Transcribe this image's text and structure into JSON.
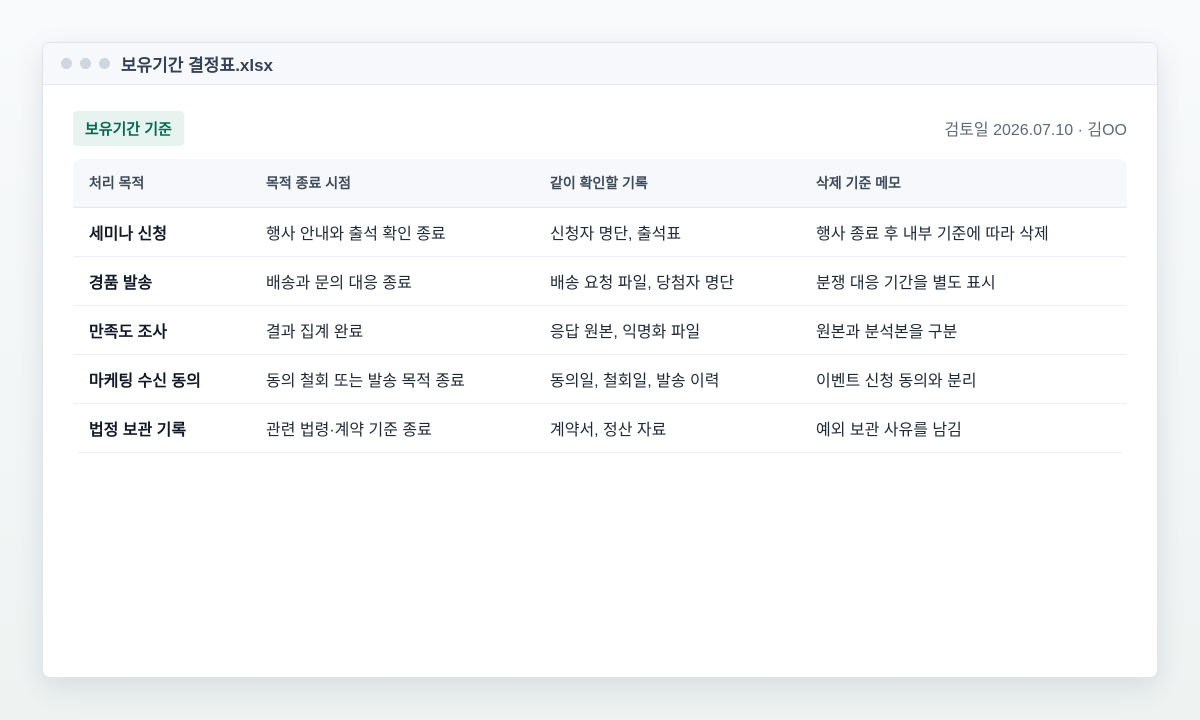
{
  "window": {
    "title": "보유기간 결정표.xlsx"
  },
  "header": {
    "badge": "보유기간 기준",
    "meta": "검토일 2026.07.10 · 김OO"
  },
  "table": {
    "columns": [
      "처리 목적",
      "목적 종료 시점",
      "같이 확인할 기록",
      "삭제 기준 메모"
    ],
    "rows": [
      {
        "purpose": "세미나 신청",
        "end_point": "행사 안내와 출석 확인 종료",
        "records": "신청자 명단, 출석표",
        "memo": "행사 종료 후 내부 기준에 따라 삭제"
      },
      {
        "purpose": "경품 발송",
        "end_point": "배송과 문의 대응 종료",
        "records": "배송 요청 파일, 당첨자 명단",
        "memo": "분쟁 대응 기간을 별도 표시"
      },
      {
        "purpose": "만족도 조사",
        "end_point": "결과 집계 완료",
        "records": "응답 원본, 익명화 파일",
        "memo": "원본과 분석본을 구분"
      },
      {
        "purpose": "마케팅 수신 동의",
        "end_point": "동의 철회 또는 발송 목적 종료",
        "records": "동의일, 철회일, 발송 이력",
        "memo": "이벤트 신청 동의와 분리"
      },
      {
        "purpose": "법정 보관 기록",
        "end_point": "관련 법령·계약 기준 종료",
        "records": "계약서, 정산 자료",
        "memo": "예외 보관 사유를 남김"
      }
    ]
  },
  "colors": {
    "accent": "#066a4f",
    "badge_bg": "#e7f3ef",
    "header_bg": "#f6f8fb"
  }
}
